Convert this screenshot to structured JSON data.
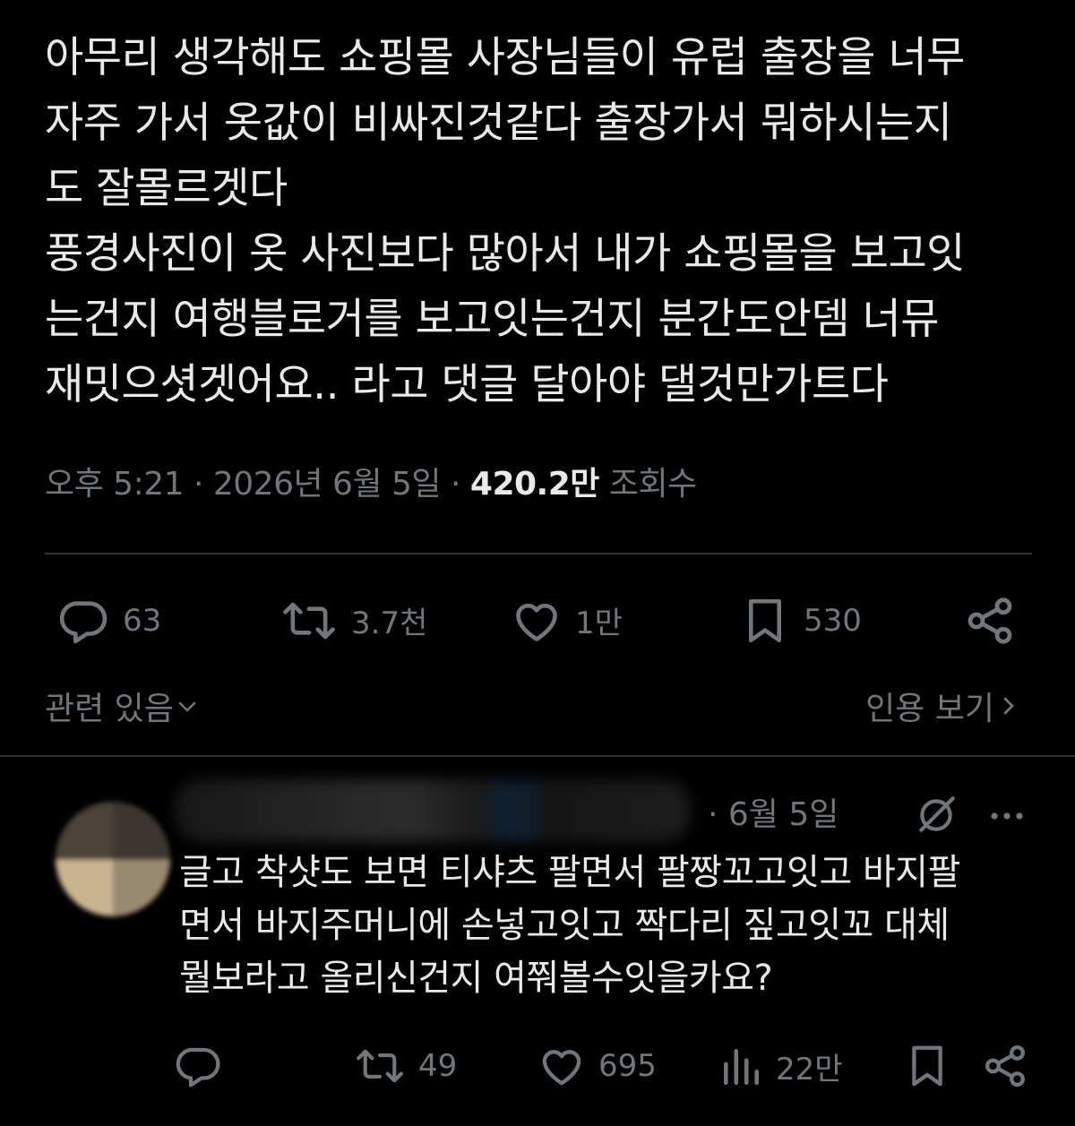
{
  "tweet": {
    "lines": [
      "아무리 생각해도 쇼핑몰 사장님들이 유럽 출장을 너무",
      "자주 가서 옷값이 비싸진것같다 출장가서 뭐하시는지",
      "도 잘몰르겟다",
      "풍경사진이 옷 사진보다 많아서 내가 쇼핑몰을 보고잇",
      "는건지 여행블로거를 보고잇는건지 분간도안뎀 너뮤",
      "재밋으셧겟어요.. 라고 댓글 달아야 댈것만가트다"
    ],
    "time": "오후 5:21",
    "separator": " · ",
    "date": "2026년 6월 5일",
    "views_count": "420.2만",
    "views_label": "조회수"
  },
  "actions": {
    "replies": "63",
    "retweets": "3.7천",
    "likes": "1만",
    "bookmarks": "530"
  },
  "related": {
    "left_label": "관련 있음",
    "right_label": "인용 보기"
  },
  "reply": {
    "date": "· 6월 5일",
    "lines": [
      "글고 착샷도 보면 티샤츠 팔면서 팔짱꼬고잇고 바지팔",
      "면서 바지주머니에 손넣고잇고 짝다리 짚고잇꼬 대체",
      "뭘보라고 올리신건지 여쭤볼수잇을카요?"
    ],
    "actions": {
      "retweets": "49",
      "likes": "695",
      "views": "22만"
    }
  },
  "colors": {
    "background": "#000000",
    "text": "#e7e9ea",
    "muted": "#71767b",
    "divider": "#2f3336"
  }
}
